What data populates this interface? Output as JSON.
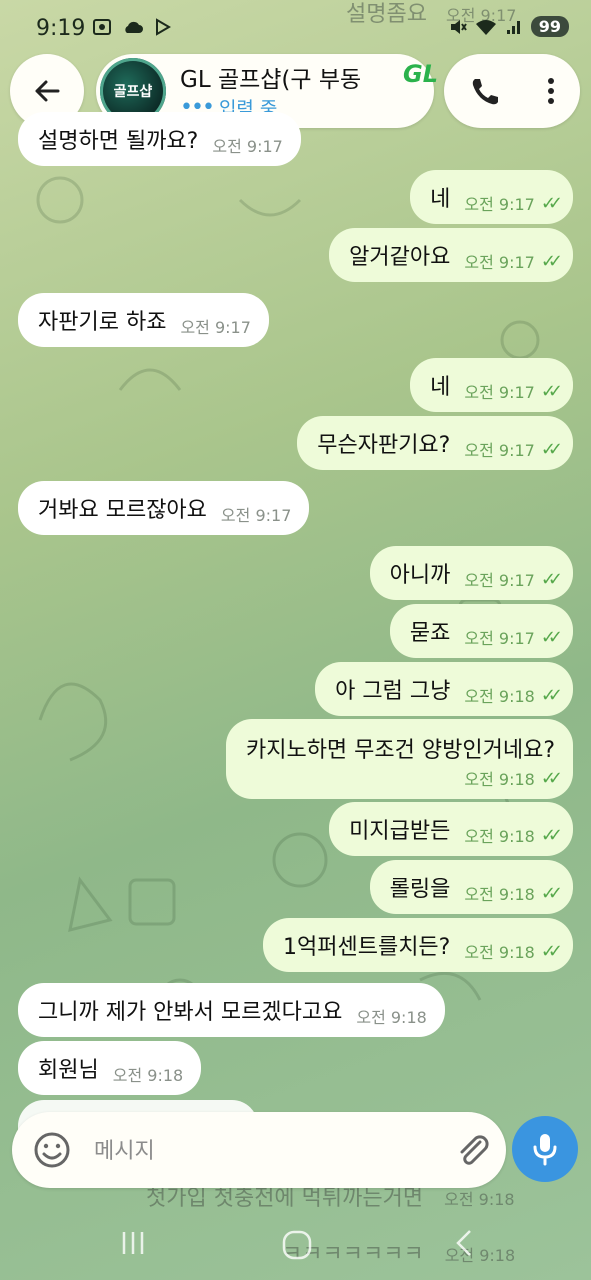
{
  "status_bar": {
    "time": "9:19",
    "battery": "99"
  },
  "header": {
    "title": "GL 골프샵(구 부동",
    "logo_text": "GL",
    "avatar_text": "골프샵",
    "status": "입력 중",
    "icons": [
      "back-arrow-icon",
      "phone-icon",
      "more-vert-icon"
    ]
  },
  "messages": [
    {
      "dir": "in",
      "text": "설명하면 될까요?",
      "time": "오전 9:17"
    },
    {
      "dir": "out",
      "text": "네",
      "time": "오전 9:17"
    },
    {
      "dir": "out",
      "text": "알거같아요",
      "time": "오전 9:17"
    },
    {
      "dir": "in",
      "text": "자판기로 하죠",
      "time": "오전 9:17"
    },
    {
      "dir": "out",
      "text": "네",
      "time": "오전 9:17"
    },
    {
      "dir": "out",
      "text": "무슨자판기요?",
      "time": "오전 9:17"
    },
    {
      "dir": "in",
      "text": "거봐요 모르잖아요",
      "time": "오전 9:17"
    },
    {
      "dir": "out",
      "text": "아니까",
      "time": "오전 9:17"
    },
    {
      "dir": "out",
      "text": "묻죠",
      "time": "오전 9:17"
    },
    {
      "dir": "out",
      "text": "아 그럼 그냥",
      "time": "오전 9:18"
    },
    {
      "dir": "out",
      "text": "카지노하면 무조건 양방인거네요?",
      "time": "오전 9:18"
    },
    {
      "dir": "out",
      "text": "미지급받든",
      "time": "오전 9:18"
    },
    {
      "dir": "out",
      "text": "롤링을",
      "time": "오전 9:18"
    },
    {
      "dir": "out",
      "text": "1억퍼센트를치든?",
      "time": "오전 9:18"
    },
    {
      "dir": "in",
      "text": "그니까 제가 안봐서 모르겠다고요",
      "time": "오전 9:18"
    },
    {
      "dir": "in",
      "text": "회원님",
      "time": "오전 9:18"
    }
  ],
  "faded_top": {
    "text": "설명좀요",
    "time": "오전 9:17"
  },
  "faded_bottom": [
    {
      "text": "첫가입 첫충전에 먹튀까는거면",
      "time": "오전 9:18"
    },
    {
      "text": "ㅋㅋㅋㅋㅋㅋㅋ",
      "time": "오전 9:18"
    }
  ],
  "composer": {
    "placeholder": "메시지"
  },
  "colors": {
    "accent": "#3a95e0",
    "out_bubble": "#eefbd9",
    "in_bubble": "#ffffff",
    "check": "#56a84b"
  }
}
